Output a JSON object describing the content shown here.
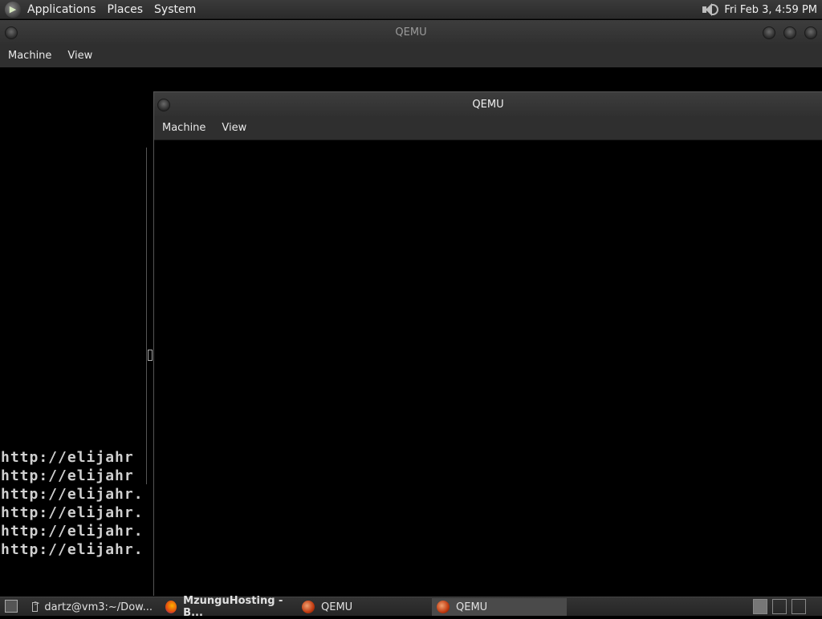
{
  "top_panel": {
    "menus": [
      "Applications",
      "Places",
      "System"
    ],
    "clock": "Fri Feb  3,  4:59 PM"
  },
  "back_window": {
    "title": "QEMU",
    "menu": [
      "Machine",
      "View"
    ],
    "terminal_lines": [
      "http://elijahr",
      "http://elijahr",
      "http://elijahr.",
      "http://elijahr.",
      "http://elijahr.",
      "http://elijahr."
    ]
  },
  "front_window": {
    "title": "QEMU",
    "menu": [
      "Machine",
      "View"
    ]
  },
  "taskbar": {
    "tasks": [
      {
        "label": "dartz@vm3:~/Dow...",
        "icon": "terminal-icon"
      },
      {
        "label": "MzunguHosting - B...",
        "icon": "firefox-icon"
      },
      {
        "label": "QEMU",
        "icon": "qemu-icon"
      },
      {
        "label": "QEMU",
        "icon": "qemu-icon",
        "active": true
      }
    ]
  },
  "colors": {
    "panel": "#2b2b2b",
    "titlebar": "#333333",
    "text": "#e6e6e6",
    "terminal_text": "#cfcfcf"
  }
}
